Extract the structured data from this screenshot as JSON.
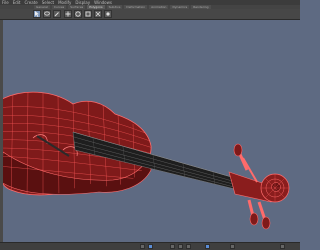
{
  "menubar": {
    "items": [
      "File",
      "Edit",
      "Create",
      "Select",
      "Modify",
      "Display",
      "Windows"
    ]
  },
  "shelf": {
    "tabs": [
      "General",
      "Curves",
      "Surfaces",
      "Polygons",
      "Subdivs",
      "Deformation",
      "Animation",
      "Dynamics",
      "Rendering"
    ]
  },
  "toolbar": {
    "icons": [
      "select-tool-icon",
      "lasso-tool-icon",
      "paint-select-icon",
      "move-tool-icon",
      "rotate-tool-icon",
      "scale-tool-icon",
      "universal-manip-icon",
      "soft-mod-icon",
      "show-manip-icon",
      "last-tool-icon"
    ]
  },
  "viewport": {
    "background": "#5e6a82",
    "object": "violin-model",
    "wire_color": "#ff5a5a",
    "body_color": "#8a1d1d"
  },
  "timeline": {
    "label": "0"
  }
}
